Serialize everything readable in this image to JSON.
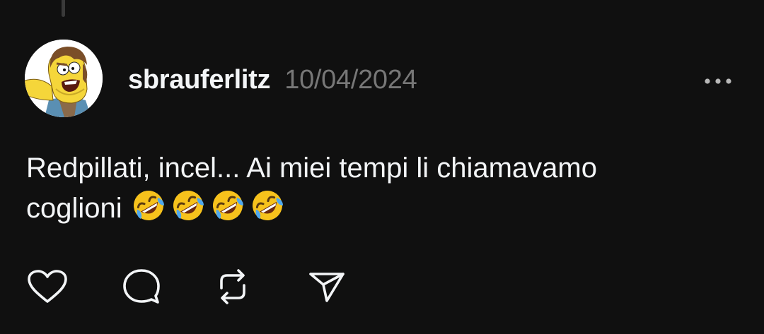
{
  "post": {
    "author": "sbrauferlitz",
    "date": "10/04/2024",
    "text_line1": "Redpillati, incel... Ai miei tempi li chiamavamo",
    "text_line2": "coglioni",
    "emojis": [
      "rolling-on-floor-laughing",
      "rolling-on-floor-laughing",
      "rolling-on-floor-laughing",
      "rolling-on-floor-laughing"
    ]
  },
  "actions": [
    {
      "icon": "heart-icon"
    },
    {
      "icon": "comment-icon"
    },
    {
      "icon": "repost-icon"
    },
    {
      "icon": "share-icon"
    }
  ],
  "menu_icon": "more-options-icon",
  "colors": {
    "background": "#101010",
    "text_primary": "#f3f5f7",
    "text_secondary": "#777777",
    "icon": "#f3f5f7"
  }
}
